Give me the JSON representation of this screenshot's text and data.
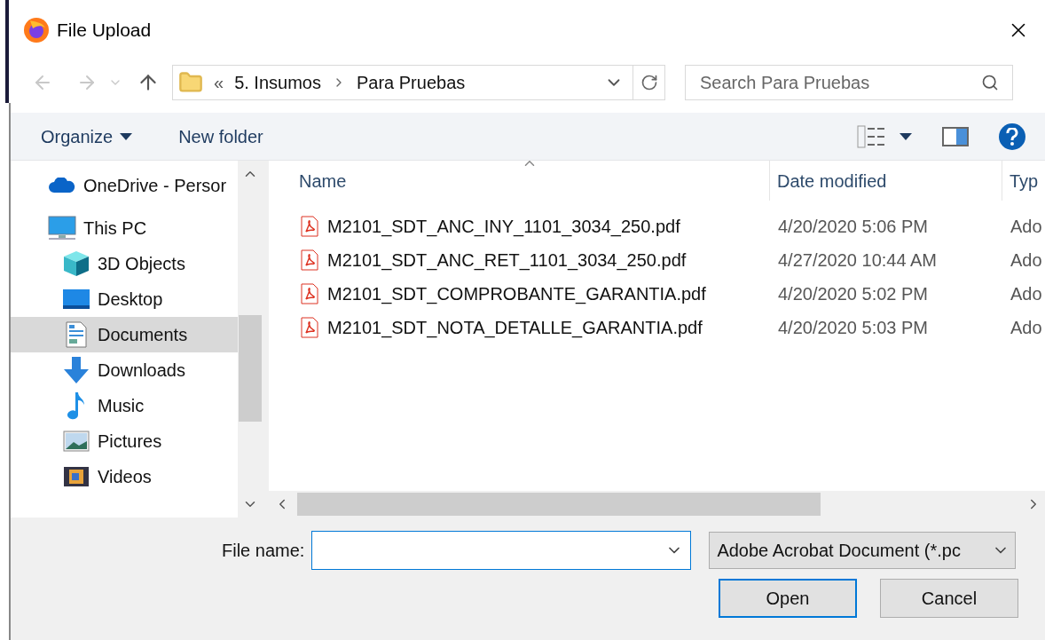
{
  "window": {
    "title": "File Upload"
  },
  "address_bar": {
    "overflow": "«",
    "path": [
      "5. Insumos",
      "Para Pruebas"
    ]
  },
  "search": {
    "placeholder": "Search Para Pruebas"
  },
  "toolbar": {
    "organize": "Organize",
    "new_folder": "New folder"
  },
  "nav_pane": {
    "items": [
      {
        "label": "OneDrive - Persor",
        "selected": false
      },
      {
        "label": "This PC",
        "selected": false,
        "children": [
          {
            "label": "3D Objects",
            "selected": false
          },
          {
            "label": "Desktop",
            "selected": false
          },
          {
            "label": "Documents",
            "selected": true
          },
          {
            "label": "Downloads",
            "selected": false
          },
          {
            "label": "Music",
            "selected": false
          },
          {
            "label": "Pictures",
            "selected": false
          },
          {
            "label": "Videos",
            "selected": false
          }
        ]
      }
    ]
  },
  "file_list": {
    "columns": [
      "Name",
      "Date modified",
      "Typ"
    ],
    "rows": [
      {
        "name": "M2101_SDT_ANC_INY_1101_3034_250.pdf",
        "date": "4/20/2020 5:06 PM",
        "type": "Ado"
      },
      {
        "name": "M2101_SDT_ANC_RET_1101_3034_250.pdf",
        "date": "4/27/2020 10:44 AM",
        "type": "Ado"
      },
      {
        "name": "M2101_SDT_COMPROBANTE_GARANTIA.pdf",
        "date": "4/20/2020 5:02 PM",
        "type": "Ado"
      },
      {
        "name": "M2101_SDT_NOTA_DETALLE_GARANTIA.pdf",
        "date": "4/20/2020 5:03 PM",
        "type": "Ado"
      }
    ]
  },
  "file_name": {
    "label": "File name:"
  },
  "file_type": {
    "value": "Adobe Acrobat Document (*.pc"
  },
  "buttons": [
    {
      "label": "Open",
      "default": true
    },
    {
      "label": "Cancel",
      "default": false
    }
  ]
}
